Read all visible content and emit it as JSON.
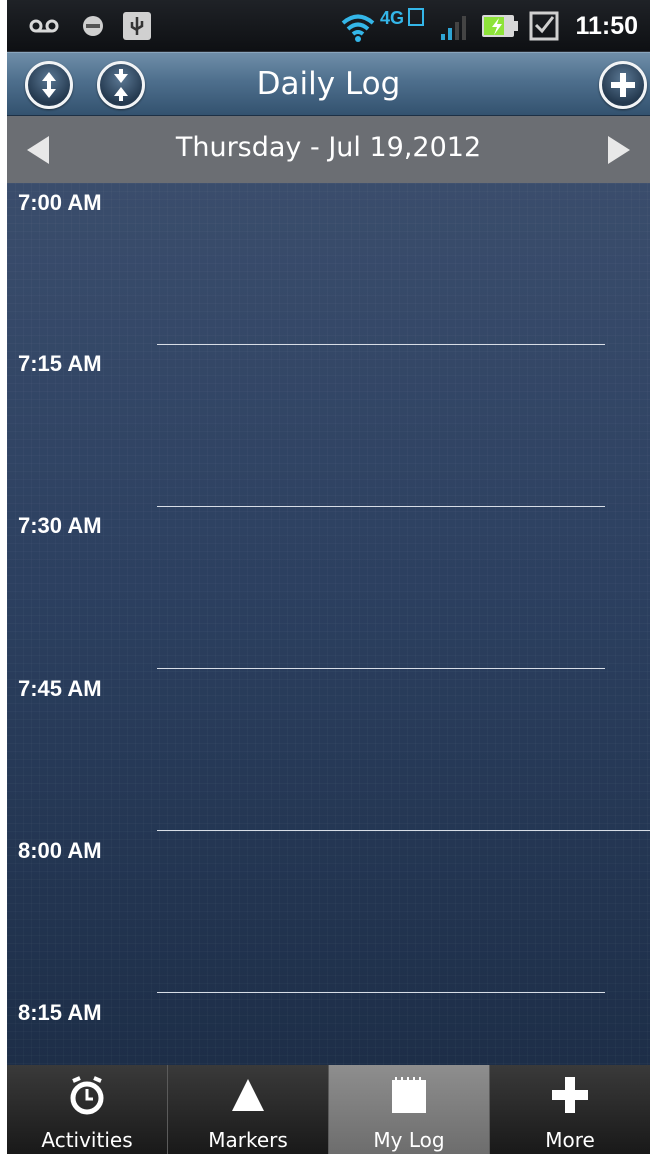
{
  "status_bar": {
    "time": "11:50",
    "network_label": "4G",
    "icons": [
      "voicemail-icon",
      "notification-dot-icon",
      "usb-icon",
      "wifi-icon",
      "4g-lte-icon",
      "signal-icon",
      "battery-charging-icon",
      "checkbox-notification-icon"
    ]
  },
  "header": {
    "title": "Daily Log",
    "left_buttons": [
      "expand-icon",
      "collapse-icon"
    ],
    "right_button": "add-icon"
  },
  "date_nav": {
    "label": "Thursday - Jul 19,2012"
  },
  "timeline": {
    "slots": [
      "7:00 AM",
      "7:15 AM",
      "7:30 AM",
      "7:45 AM",
      "8:00 AM",
      "8:15 AM"
    ]
  },
  "tabs": [
    {
      "label": "Activities",
      "icon": "stopwatch-icon",
      "active": false
    },
    {
      "label": "Markers",
      "icon": "triangle-marker-icon",
      "active": false
    },
    {
      "label": "My Log",
      "icon": "notepad-icon",
      "active": true
    },
    {
      "label": "More",
      "icon": "plus-icon",
      "active": false
    }
  ],
  "colors": {
    "title_bar": "#4e6f8d",
    "date_bar": "#6b6e73",
    "timeline_bg": "#2a3e5c",
    "tab_active": "#8e8e8e"
  }
}
